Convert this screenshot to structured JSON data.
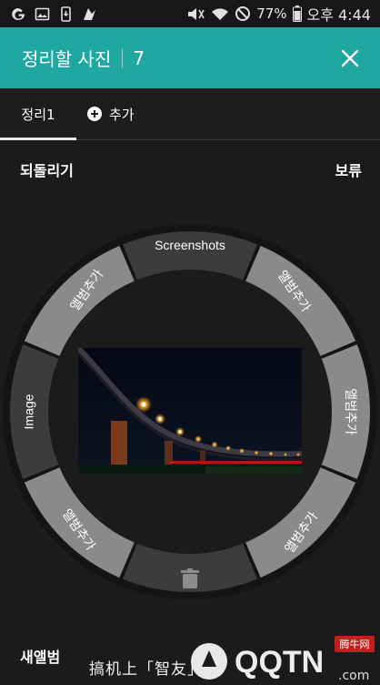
{
  "status_bar": {
    "battery": "77%",
    "time": "오후 4:44"
  },
  "header": {
    "title": "정리할 사진",
    "count": "7",
    "close_icon": "close-icon"
  },
  "tabs": [
    {
      "label": "정리1",
      "active": true
    },
    {
      "label": "추가",
      "icon": "plus-circle-icon"
    }
  ],
  "actions": {
    "undo_label": "되돌리기",
    "hold_label": "보류"
  },
  "wheel": {
    "top_label": "Screenshots",
    "left_label": "Image",
    "album_add_label": "앨범추가",
    "bottom_icon": "trash-icon"
  },
  "footer": {
    "new_album_label": "새앨범",
    "watermark_text": "搞机上「智友」",
    "watermark_logo_text": "QQTN",
    "watermark_badge": "腾牛网",
    "watermark_domain": ".com"
  },
  "colors": {
    "accent": "#1fa8a2",
    "segment_light": "#8a8a8a",
    "segment_dark": "#3c3c3c",
    "background": "#1b1b1b"
  }
}
